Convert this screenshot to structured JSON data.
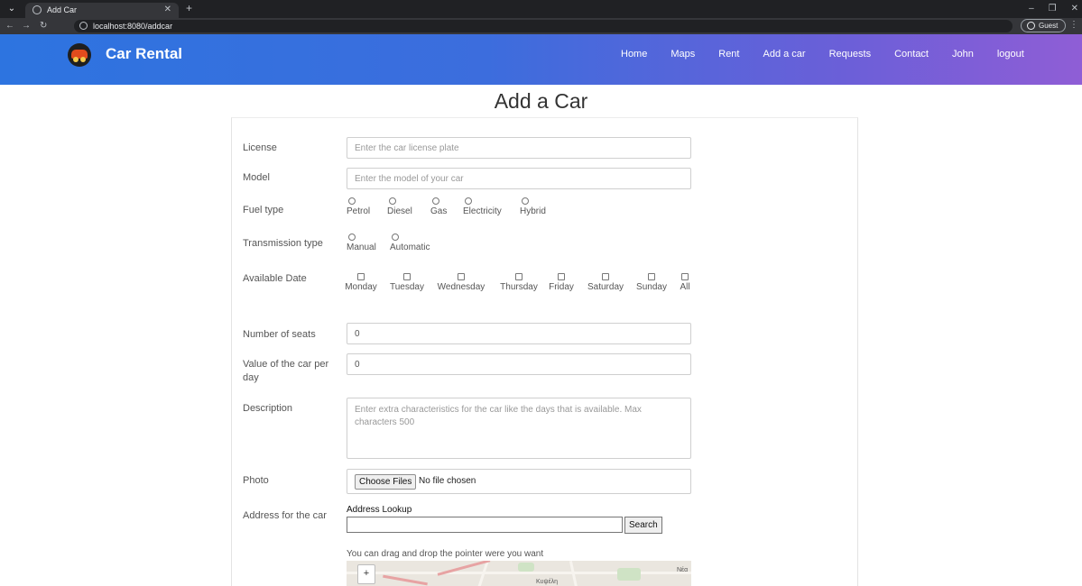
{
  "browser": {
    "tab_title": "Add Car",
    "url": "localhost:8080/addcar",
    "profile_label": "Guest"
  },
  "navbar": {
    "brand": "Car Rental",
    "links": [
      "Home",
      "Maps",
      "Rent",
      "Add a car",
      "Requests",
      "Contact",
      "John",
      "logout"
    ]
  },
  "page": {
    "title": "Add a Car"
  },
  "form": {
    "license": {
      "label": "License",
      "placeholder": "Enter the car license plate"
    },
    "model": {
      "label": "Model",
      "placeholder": "Enter the model of your car"
    },
    "fuel": {
      "label": "Fuel type",
      "options": [
        "Petrol",
        "Diesel",
        "Gas",
        "Electricity",
        "Hybrid"
      ]
    },
    "transmission": {
      "label": "Transmission type",
      "options": [
        "Manual",
        "Automatic"
      ]
    },
    "available": {
      "label": "Available Date",
      "options": [
        "Monday",
        "Tuesday",
        "Wednesday",
        "Thursday",
        "Friday",
        "Saturday",
        "Sunday",
        "All"
      ]
    },
    "seats": {
      "label": "Number of seats",
      "value": "0"
    },
    "price": {
      "label_line1": "Value of the car per",
      "label_line2": "day",
      "value": "0"
    },
    "description": {
      "label": "Description",
      "placeholder": "Enter extra characteristics for the car like the days that is available. Max characters 500"
    },
    "photo": {
      "label": "Photo",
      "button": "Choose Files",
      "status": "No file chosen"
    },
    "address": {
      "label": "Address for the car",
      "lookup_title": "Address Lookup",
      "search_button": "Search",
      "hint": "You can drag and drop the pointer were you want",
      "map_zoom_in": "+",
      "map_labels": [
        "Κυψέλη",
        "Νέα"
      ]
    }
  }
}
